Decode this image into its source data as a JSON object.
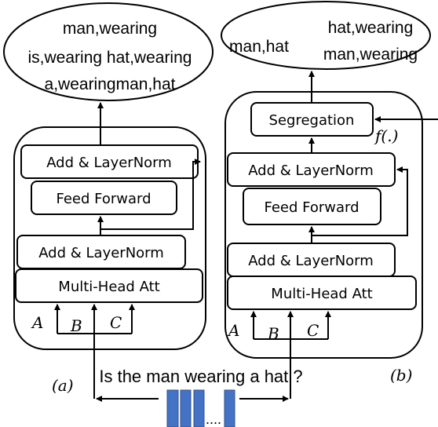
{
  "panel_a": {
    "output_lines": [
      "man,wearing",
      "is,wearing hat,wearing",
      "a,wearingman,hat"
    ],
    "blocks": {
      "add_norm_top": "Add & LayerNorm",
      "feed_forward": "Feed Forward",
      "add_norm_bottom": "Add & LayerNorm",
      "attention": "Multi-Head Att"
    },
    "inputs": [
      "A",
      "B",
      "C"
    ],
    "label": "(a)"
  },
  "panel_b": {
    "output_left": "man,hat",
    "output_right": [
      "hat,wearing",
      "man,wearing"
    ],
    "blocks": {
      "segregation": "Segregation",
      "add_norm_top": "Add & LayerNorm",
      "feed_forward": "Feed Forward",
      "add_norm_bottom": "Add & LayerNorm",
      "attention": "Multi-Head Att"
    },
    "function_label": "f(.)",
    "inputs": [
      "A",
      "B",
      "C"
    ],
    "label": "(b)"
  },
  "question": "Is the man wearing a hat ?",
  "embedding_ellipsis": "....",
  "colors": {
    "embedding": "#4472c4",
    "stroke": "#000000"
  }
}
